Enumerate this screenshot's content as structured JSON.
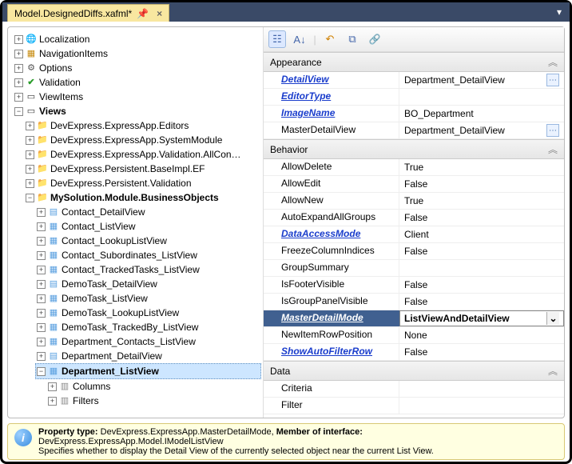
{
  "tab": {
    "title": "Model.DesignedDiffs.xafml*",
    "pin": "📌",
    "close": "×"
  },
  "tree": {
    "root": [
      {
        "label": "Localization",
        "iconCls": "i-globe",
        "glyph": "🌐"
      },
      {
        "label": "NavigationItems",
        "iconCls": "i-nav",
        "glyph": "▦"
      },
      {
        "label": "Options",
        "iconCls": "i-opt",
        "glyph": "⚙"
      },
      {
        "label": "Validation",
        "iconCls": "i-valid",
        "glyph": "✔"
      },
      {
        "label": "ViewItems",
        "iconCls": "i-view",
        "glyph": "▭"
      },
      {
        "label": "Views",
        "iconCls": "i-view",
        "glyph": "▭",
        "bold": true
      }
    ],
    "views": [
      {
        "label": "DevExpress.ExpressApp.Editors"
      },
      {
        "label": "DevExpress.ExpressApp.SystemModule"
      },
      {
        "label": "DevExpress.ExpressApp.Validation.AllCon…"
      },
      {
        "label": "DevExpress.Persistent.BaseImpl.EF"
      },
      {
        "label": "DevExpress.Persistent.Validation"
      },
      {
        "label": "MySolution.Module.BusinessObjects",
        "bold": true
      }
    ],
    "bo": [
      {
        "label": "Contact_DetailView",
        "icon": "form"
      },
      {
        "label": "Contact_ListView",
        "icon": "list"
      },
      {
        "label": "Contact_LookupListView",
        "icon": "list"
      },
      {
        "label": "Contact_Subordinates_ListView",
        "icon": "list"
      },
      {
        "label": "Contact_TrackedTasks_ListView",
        "icon": "list"
      },
      {
        "label": "DemoTask_DetailView",
        "icon": "form"
      },
      {
        "label": "DemoTask_ListView",
        "icon": "list"
      },
      {
        "label": "DemoTask_LookupListView",
        "icon": "list"
      },
      {
        "label": "DemoTask_TrackedBy_ListView",
        "icon": "list"
      },
      {
        "label": "Department_Contacts_ListView",
        "icon": "list"
      },
      {
        "label": "Department_DetailView",
        "icon": "form"
      },
      {
        "label": "Department_ListView",
        "icon": "list",
        "bold": true,
        "selected": true
      }
    ],
    "deptChildren": [
      {
        "label": "Columns",
        "glyph": "▥"
      },
      {
        "label": "Filters",
        "glyph": "▥"
      }
    ]
  },
  "categories": {
    "appearance": "Appearance",
    "behavior": "Behavior",
    "data": "Data"
  },
  "props": {
    "appearance": [
      {
        "name": "DetailView",
        "value": "Department_DetailView",
        "link": true,
        "btn": true
      },
      {
        "name": "EditorType",
        "value": "",
        "link": true
      },
      {
        "name": "ImageName",
        "value": "BO_Department",
        "link": true
      },
      {
        "name": "MasterDetailView",
        "value": "Department_DetailView",
        "link": false,
        "btn": true
      }
    ],
    "behavior": [
      {
        "name": "AllowDelete",
        "value": "True"
      },
      {
        "name": "AllowEdit",
        "value": "False"
      },
      {
        "name": "AllowNew",
        "value": "True"
      },
      {
        "name": "AutoExpandAllGroups",
        "value": "False"
      },
      {
        "name": "DataAccessMode",
        "value": "Client",
        "link": true
      },
      {
        "name": "FreezeColumnIndices",
        "value": "False"
      },
      {
        "name": "GroupSummary",
        "value": ""
      },
      {
        "name": "IsFooterVisible",
        "value": "False"
      },
      {
        "name": "IsGroupPanelVisible",
        "value": "False"
      },
      {
        "name": "MasterDetailMode",
        "value": "ListViewAndDetailView",
        "link": true,
        "selected": true
      },
      {
        "name": "NewItemRowPosition",
        "value": "None"
      },
      {
        "name": "ShowAutoFilterRow",
        "value": "False",
        "link": true
      }
    ],
    "data": [
      {
        "name": "Criteria",
        "value": ""
      },
      {
        "name": "Filter",
        "value": ""
      }
    ]
  },
  "help": {
    "l1a": "Property type: ",
    "l1b": "DevExpress.ExpressApp.MasterDetailMode,   ",
    "l1c": "Member of interface:",
    "l2": "DevExpress.ExpressApp.Model.IModelListView",
    "l3": "Specifies whether to display the Detail View of the currently selected object near the current List View."
  }
}
